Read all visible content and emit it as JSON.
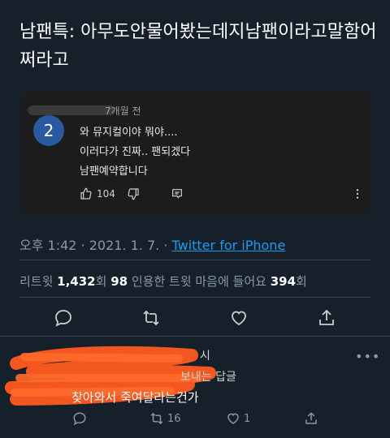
{
  "tweet": {
    "text": "남팬특: 아무도안물어봤는데지남팬이라고말함어쩌라고"
  },
  "comment_card": {
    "time": "7개월 전",
    "avatar_letter": "2",
    "lines": [
      "와 뮤지컬이야 뭐야....",
      "이러다가 진짜.. 팬되겠다",
      "남팬예약합니다"
    ],
    "like_count": "104",
    "icons": [
      "thumbs-up-icon",
      "thumbs-down-icon",
      "comment-icon",
      "more-vertical-icon"
    ]
  },
  "meta": {
    "time_date": "오후 1:42 · 2021. 1. 7. · ",
    "source": "Twitter for iPhone"
  },
  "stats": {
    "retweets_label": "리트윗 ",
    "retweets_count": "1,432",
    "retweets_unit": "회  ",
    "quotes_count": "98",
    "quotes_label": " 인용한 트윗  마음에 들어요 ",
    "likes_count": "394",
    "likes_unit": "회"
  },
  "actions": [
    "reply-icon",
    "retweet-icon",
    "like-icon",
    "share-icon"
  ],
  "reply": {
    "name_tail": "시",
    "sub_tail": "보내는 답글",
    "text": "찾아와서 죽여달라는건가",
    "more": "•••",
    "retweet_count": "16",
    "like_count": "1"
  },
  "colors": {
    "background": "#15202b",
    "link": "#1d9bf0",
    "muted": "#8b98a5",
    "scribble": "#ff5a1f"
  }
}
